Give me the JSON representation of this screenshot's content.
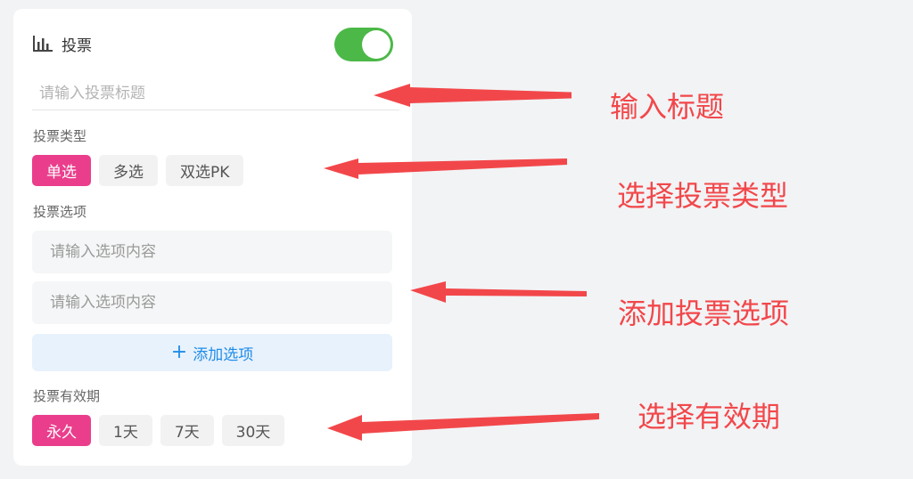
{
  "panel": {
    "icon": "bar-chart-icon",
    "title": "投票",
    "toggle_on": true,
    "title_placeholder": "请输入投票标题",
    "type_label": "投票类型",
    "types": [
      "单选",
      "多选",
      "双选PK"
    ],
    "selected_type": "单选",
    "options_label": "投票选项",
    "option_placeholders": [
      "请输入选项内容",
      "请输入选项内容"
    ],
    "add_option_label": "添加选项",
    "validity_label": "投票有效期",
    "validity": [
      "永久",
      "1天",
      "7天",
      "30天"
    ],
    "selected_validity": "永久"
  },
  "annotations": [
    "输入标题",
    "选择投票类型",
    "添加投票选项",
    "选择有效期"
  ],
  "colors": {
    "accent_pink": "#ea3e8c",
    "toggle_green": "#4cb848",
    "link_blue": "#1f8ce8",
    "annotation_red": "#f2474a"
  }
}
